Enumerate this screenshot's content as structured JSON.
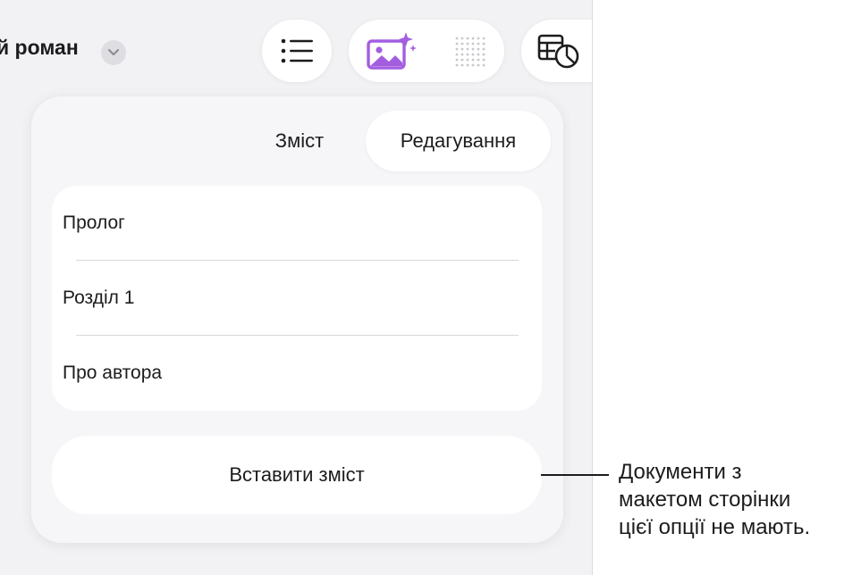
{
  "document": {
    "title": "й роман"
  },
  "icons": {
    "title_menu": "chevron-down-icon",
    "list": "list-icon",
    "media": "image-sparkle-icon",
    "grid": "dot-grid-icon",
    "chart": "table-chart-icon"
  },
  "popover": {
    "tabs": [
      {
        "label": "Зміст",
        "selected": false
      },
      {
        "label": "Редагування",
        "selected": true
      }
    ],
    "toc_entries": [
      {
        "label": "Пролог"
      },
      {
        "label": "Розділ 1"
      },
      {
        "label": "Про автора"
      }
    ],
    "insert_button": "Вставити зміст"
  },
  "callout": {
    "line1": "Документи з",
    "line2": "макетом сторінки",
    "line3": "цієї опції не мають."
  },
  "colors": {
    "accent_purple": "#a35ee0",
    "panel_bg": "#f6f6f8",
    "screen_bg": "#f2f2f4"
  }
}
